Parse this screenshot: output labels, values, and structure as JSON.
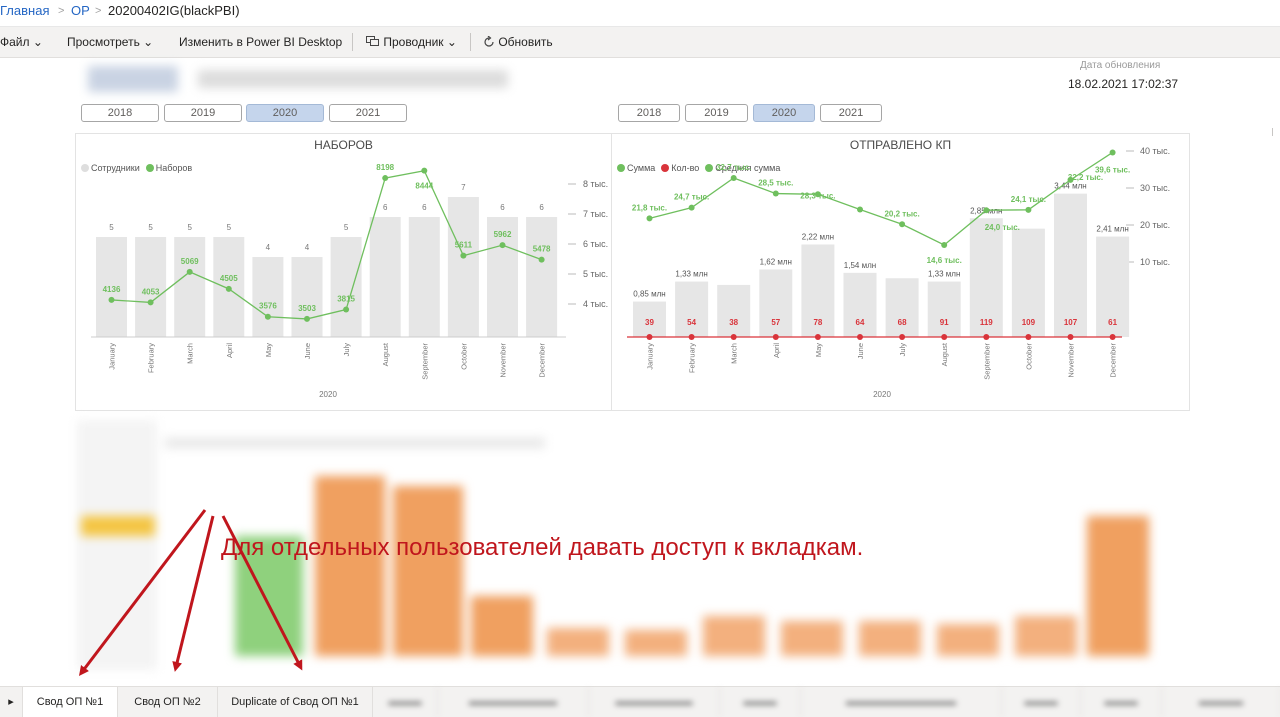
{
  "breadcrumb": {
    "home": "Главная",
    "section": "OP",
    "current": "20200402IG(blackPBI)"
  },
  "toolbar": {
    "file": "Файл",
    "view": "Просмотреть",
    "edit_desktop": "Изменить в Power BI Desktop",
    "explorer": "Проводник",
    "refresh": "Обновить"
  },
  "report": {
    "update_label": "Дата обновления",
    "update_value": "18.02.2021 17:02:37",
    "years_left": [
      "2018",
      "2019",
      "2020",
      "2021"
    ],
    "years_right": [
      "2018",
      "2019",
      "2020",
      "2021"
    ],
    "selected_year": "2020"
  },
  "annotation": "Для отдельных пользователей давать доступ к вкладкам.",
  "tabs": [
    "Свод ОП №1",
    "Свод ОП №2",
    "Duplicate of Свод ОП №1"
  ],
  "colors": {
    "accent_green": "#6fbf5e",
    "bar_gray": "#e6e6e6",
    "red": "#d9343b",
    "annotation_red": "#c0161d"
  },
  "chart_data": [
    {
      "type": "bar",
      "title": "НАБОРОВ",
      "legend": [
        "Сотрудники",
        "Наборов"
      ],
      "categories": [
        "January",
        "February",
        "March",
        "April",
        "May",
        "June",
        "July",
        "August",
        "September",
        "October",
        "November",
        "December"
      ],
      "xgroup": "2020",
      "series": [
        {
          "name": "Сотрудники",
          "type": "bar",
          "values": [
            5,
            5,
            5,
            5,
            4,
            4,
            5,
            6,
            6,
            7,
            6,
            6
          ]
        },
        {
          "name": "Наборов",
          "type": "line",
          "values": [
            4136,
            4053,
            5069,
            4505,
            3576,
            3503,
            3815,
            8198,
            8444,
            5611,
            5962,
            5478
          ]
        }
      ],
      "y2_ticks": [
        "8 тыс.",
        "7 тыс.",
        "6 тыс.",
        "5 тыс.",
        "4 тыс."
      ],
      "ylim_bar": [
        0,
        7.5
      ],
      "ylim_line": [
        3500,
        8500
      ]
    },
    {
      "type": "bar",
      "title": "ОТПРАВЛЕНО КП",
      "legend": [
        "Сумма",
        "Кол-во",
        "Средняя сумма"
      ],
      "categories": [
        "January",
        "February",
        "March",
        "April",
        "May",
        "June",
        "July",
        "August",
        "September",
        "October",
        "November",
        "December"
      ],
      "xgroup": "2020",
      "series": [
        {
          "name": "Сумма",
          "type": "bar",
          "values": [
            0.85,
            1.33,
            1.25,
            1.62,
            2.22,
            1.54,
            1.41,
            1.33,
            2.85,
            2.6,
            3.44,
            2.41
          ],
          "labels": [
            "0,85 млн",
            "1,33 млн",
            "",
            "1,62 млн",
            "2,22 млн",
            "1,54 млн",
            "",
            "1,33 млн",
            "2,85 млн",
            "",
            "3,44 млн",
            "2,41 млн"
          ]
        },
        {
          "name": "Кол-во",
          "type": "line",
          "values": [
            39,
            54,
            38,
            57,
            78,
            64,
            68,
            91,
            119,
            109,
            107,
            61
          ]
        },
        {
          "name": "Средняя сумма",
          "type": "line",
          "values": [
            21.8,
            24.7,
            32.7,
            28.5,
            28.3,
            24.2,
            20.2,
            14.6,
            24.0,
            24.1,
            32.2,
            39.6
          ],
          "labels": [
            "21,8 тыс.",
            "24,7 тыс.",
            "32,7 тыс.",
            "28,5 тыс.",
            "28,3 тыс.",
            "",
            "20,2 тыс.",
            "14,6 тыс.",
            "24,0 тыс.",
            "24,1 тыс.",
            "32,2 тыс.",
            "39,6 тыс."
          ]
        }
      ],
      "y2_ticks": [
        "40 тыс.",
        "30 тыс.",
        "20 тыс.",
        "10 тыс."
      ],
      "ylim_line": [
        0,
        40
      ]
    }
  ]
}
